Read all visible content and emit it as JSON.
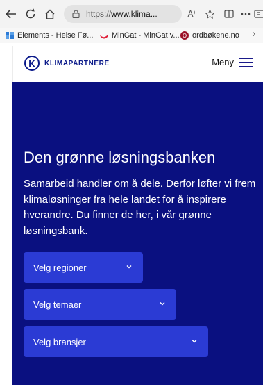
{
  "browser": {
    "url_prefix": "https://",
    "url_domain": "www.klima...",
    "read_aloud": "A⁾",
    "bookmarks": [
      {
        "label": "Elements - Helse Fø...",
        "icon": "grid-favicon-icon",
        "color": "#2d7bd6"
      },
      {
        "label": "MinGat - MinGat v...",
        "icon": "mingat-favicon-icon",
        "color": "#e0203a"
      },
      {
        "label": "ordbøkene.no",
        "icon": "ordbokene-favicon-icon",
        "color": "#9b1027"
      }
    ],
    "bookmarks_more": "›"
  },
  "header": {
    "logo_mark": "K",
    "logo_text": "KLIMAPARTNERE",
    "menu_label": "Meny"
  },
  "hero": {
    "title": "Den grønne løsningsbanken",
    "text": "Samarbeid handler om å dele. Derfor løfter vi frem klimaløsninger fra hele landet for å inspirere hverandre. Du finner de her, i vår grønne løsningsbank.",
    "background": "#0a1080",
    "dropdown_color": "#2b3bd4"
  },
  "filters": [
    {
      "label": "Velg regioner"
    },
    {
      "label": "Velg temaer"
    },
    {
      "label": "Velg bransjer"
    }
  ]
}
